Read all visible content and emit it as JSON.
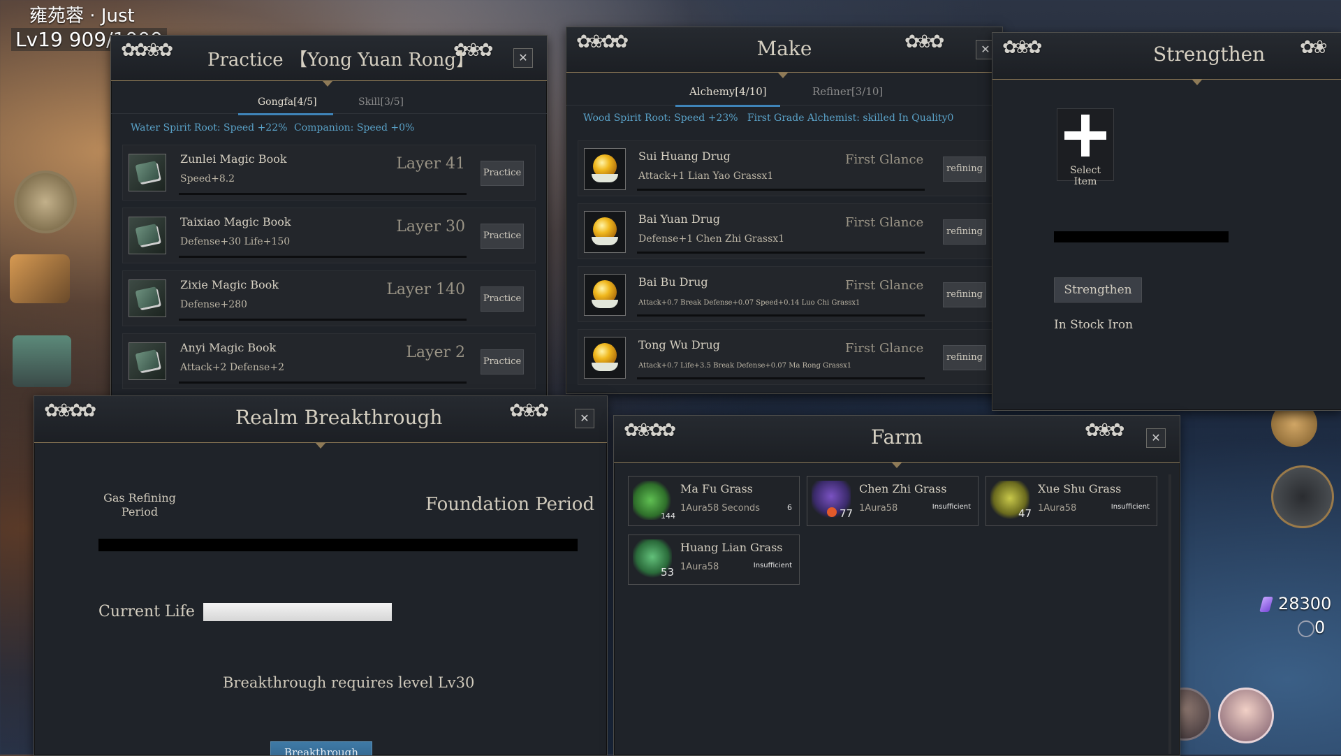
{
  "player": {
    "name": "雍苑蓉 · Just",
    "level_exp": "Lv19  909/1000"
  },
  "practice": {
    "title": "Practice 【Yong Yuan Rong】",
    "tabs": [
      "Gongfa[4/5]",
      "Skill[3/5]"
    ],
    "stats": [
      "Water Spirit Root: Speed +22%",
      "Companion: Speed +0%"
    ],
    "rows": [
      {
        "name": "Zunlei Magic Book",
        "effect": "Speed+8.2",
        "level": "Layer 41",
        "button": "Practice"
      },
      {
        "name": "Taixiao Magic Book",
        "effect": "Defense+30 Life+150",
        "level": "Layer 30",
        "button": "Practice"
      },
      {
        "name": "Zixie Magic Book",
        "effect": "Defense+280",
        "level": "Layer 140",
        "button": "Practice"
      },
      {
        "name": "Anyi Magic Book",
        "effect": "Attack+2 Defense+2",
        "level": "Layer 2",
        "button": "Practice"
      }
    ]
  },
  "make": {
    "title": "Make",
    "tabs": [
      "Alchemy[4/10]",
      "Refiner[3/10]"
    ],
    "stats": "Wood Spirit Root: Speed +23%   First Grade Alchemist: skilled In Quality0",
    "rows": [
      {
        "name": "Sui Huang Drug",
        "effect": "Attack+1  Lian Yao Grassx1",
        "grade": "First Glance",
        "button": "refining"
      },
      {
        "name": "Bai Yuan Drug",
        "effect": "Defense+1  Chen Zhi Grassx1",
        "grade": "First Glance",
        "button": "refining"
      },
      {
        "name": "Bai Bu Drug",
        "effect": "Attack+0.7 Break Defense+0.07 Speed+0.14  Luo Chi Grassx1",
        "grade": "First Glance",
        "button": "refining"
      },
      {
        "name": "Tong Wu Drug",
        "effect": "Attack+0.7 Life+3.5 Break Defense+0.07  Ma Rong Grassx1",
        "grade": "First Glance",
        "button": "refining"
      }
    ]
  },
  "strengthen": {
    "title": "Strengthen",
    "select_label": "Select Item",
    "button": "Strengthen",
    "stock": "In Stock Iron"
  },
  "realm": {
    "title": "Realm Breakthrough",
    "from_stage": "Gas Refining Period",
    "to_stage": "Foundation Period",
    "life_label": "Current Life",
    "requirement": "Breakthrough requires level Lv30",
    "button": "Breakthrough"
  },
  "farm": {
    "title": "Farm",
    "plots": [
      {
        "name": "Ma Fu Grass",
        "count": "144",
        "aura": "1Aura58 Seconds",
        "status": "6",
        "herb_color": "#3f8a3a"
      },
      {
        "name": "Chen Zhi Grass",
        "count": "77",
        "aura": "1Aura58",
        "status": "Insufficient",
        "herb_color": "#5a3f8a"
      },
      {
        "name": "Xue Shu Grass",
        "count": "47",
        "aura": "1Aura58",
        "status": "Insufficient",
        "herb_color": "#9a9a2a"
      },
      {
        "name": "Huang Lian Grass",
        "count": "53",
        "aura": "1Aura58",
        "status": "Insufficient",
        "herb_color": "#3f8a4a"
      }
    ]
  },
  "currency": {
    "gems": "28300",
    "spirit": "0"
  },
  "colors": {
    "accent_blue": "#3f84b8",
    "stat_blue": "#5aa2c8",
    "gold_line": "#8e7a57"
  }
}
